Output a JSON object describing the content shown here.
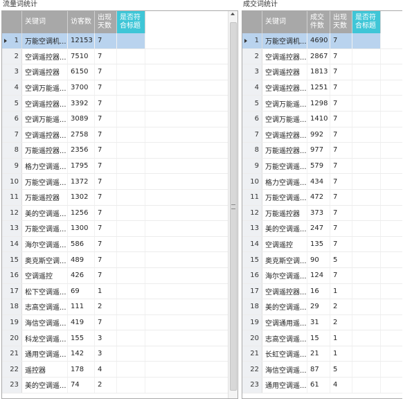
{
  "left_panel": {
    "title": "流量词统计",
    "columns": [
      "",
      "关键词",
      "访客数",
      "出现天数",
      "是否符合标题"
    ],
    "rows": [
      {
        "idx": "1",
        "kw": "万能空调机...",
        "v": "12153",
        "d": "7",
        "t": ""
      },
      {
        "idx": "2",
        "kw": "空调遥控器...",
        "v": "7510",
        "d": "7",
        "t": ""
      },
      {
        "idx": "3",
        "kw": "空调遥控器",
        "v": "6150",
        "d": "7",
        "t": ""
      },
      {
        "idx": "4",
        "kw": "空调万能遥...",
        "v": "3700",
        "d": "7",
        "t": ""
      },
      {
        "idx": "5",
        "kw": "空调遥控器...",
        "v": "3392",
        "d": "7",
        "t": ""
      },
      {
        "idx": "6",
        "kw": "空调万能遥...",
        "v": "3089",
        "d": "7",
        "t": ""
      },
      {
        "idx": "7",
        "kw": "空调遥控器...",
        "v": "2758",
        "d": "7",
        "t": ""
      },
      {
        "idx": "8",
        "kw": "万能遥控器...",
        "v": "2356",
        "d": "7",
        "t": ""
      },
      {
        "idx": "9",
        "kw": "格力空调遥...",
        "v": "1795",
        "d": "7",
        "t": ""
      },
      {
        "idx": "10",
        "kw": "万能空调遥...",
        "v": "1372",
        "d": "7",
        "t": ""
      },
      {
        "idx": "11",
        "kw": "万能遥控器",
        "v": "1302",
        "d": "7",
        "t": ""
      },
      {
        "idx": "12",
        "kw": "美的空调遥...",
        "v": "1256",
        "d": "7",
        "t": ""
      },
      {
        "idx": "13",
        "kw": "万能空调遥...",
        "v": "1300",
        "d": "7",
        "t": ""
      },
      {
        "idx": "14",
        "kw": "海尔空调遥...",
        "v": "586",
        "d": "7",
        "t": ""
      },
      {
        "idx": "15",
        "kw": "奥克斯空调...",
        "v": "489",
        "d": "7",
        "t": ""
      },
      {
        "idx": "16",
        "kw": "空调遥控",
        "v": "426",
        "d": "7",
        "t": ""
      },
      {
        "idx": "17",
        "kw": "松下空调遥...",
        "v": "69",
        "d": "1",
        "t": ""
      },
      {
        "idx": "18",
        "kw": "志高空调遥...",
        "v": "111",
        "d": "2",
        "t": ""
      },
      {
        "idx": "19",
        "kw": "海信空调遥...",
        "v": "419",
        "d": "7",
        "t": ""
      },
      {
        "idx": "20",
        "kw": "科龙空调遥...",
        "v": "155",
        "d": "3",
        "t": ""
      },
      {
        "idx": "21",
        "kw": "通用空调遥...",
        "v": "142",
        "d": "3",
        "t": ""
      },
      {
        "idx": "22",
        "kw": "遥控器",
        "v": "178",
        "d": "4",
        "t": ""
      },
      {
        "idx": "23",
        "kw": "美的空调遥...",
        "v": "74",
        "d": "2",
        "t": ""
      }
    ]
  },
  "right_panel": {
    "title": "成交词统计",
    "columns": [
      "",
      "关键词",
      "成交件数",
      "出现天数",
      "是否符合标题"
    ],
    "rows": [
      {
        "idx": "1",
        "kw": "万能空调机...",
        "v": "4690",
        "d": "7",
        "t": ""
      },
      {
        "idx": "2",
        "kw": "空调遥控器...",
        "v": "2867",
        "d": "7",
        "t": ""
      },
      {
        "idx": "3",
        "kw": "空调遥控器",
        "v": "1813",
        "d": "7",
        "t": ""
      },
      {
        "idx": "4",
        "kw": "空调遥控器...",
        "v": "1251",
        "d": "7",
        "t": ""
      },
      {
        "idx": "5",
        "kw": "空调万能遥...",
        "v": "1298",
        "d": "7",
        "t": ""
      },
      {
        "idx": "6",
        "kw": "空调万能遥...",
        "v": "1410",
        "d": "7",
        "t": ""
      },
      {
        "idx": "7",
        "kw": "空调遥控器...",
        "v": "992",
        "d": "7",
        "t": ""
      },
      {
        "idx": "8",
        "kw": "万能遥控器...",
        "v": "977",
        "d": "7",
        "t": ""
      },
      {
        "idx": "9",
        "kw": "万能空调遥...",
        "v": "579",
        "d": "7",
        "t": ""
      },
      {
        "idx": "10",
        "kw": "格力空调遥...",
        "v": "434",
        "d": "7",
        "t": ""
      },
      {
        "idx": "11",
        "kw": "万能空调遥...",
        "v": "472",
        "d": "7",
        "t": ""
      },
      {
        "idx": "12",
        "kw": "万能遥控器",
        "v": "373",
        "d": "7",
        "t": ""
      },
      {
        "idx": "13",
        "kw": "美的空调遥...",
        "v": "247",
        "d": "7",
        "t": ""
      },
      {
        "idx": "14",
        "kw": "空调遥控",
        "v": "135",
        "d": "7",
        "t": ""
      },
      {
        "idx": "15",
        "kw": "奥克斯空调...",
        "v": "90",
        "d": "5",
        "t": ""
      },
      {
        "idx": "16",
        "kw": "海尔空调遥...",
        "v": "124",
        "d": "7",
        "t": ""
      },
      {
        "idx": "17",
        "kw": "空调遥控器...",
        "v": "16",
        "d": "1",
        "t": ""
      },
      {
        "idx": "18",
        "kw": "美的空调遥...",
        "v": "29",
        "d": "2",
        "t": ""
      },
      {
        "idx": "19",
        "kw": "空调通用遥...",
        "v": "31",
        "d": "2",
        "t": ""
      },
      {
        "idx": "20",
        "kw": "志高空调遥...",
        "v": "15",
        "d": "1",
        "t": ""
      },
      {
        "idx": "21",
        "kw": "长虹空调遥...",
        "v": "21",
        "d": "1",
        "t": ""
      },
      {
        "idx": "22",
        "kw": "海信空调遥...",
        "v": "87",
        "d": "5",
        "t": ""
      },
      {
        "idx": "23",
        "kw": "通用空调遥...",
        "v": "61",
        "d": "4",
        "t": ""
      }
    ]
  },
  "selected_row_index": 0,
  "colors": {
    "header": "#a8a8a8",
    "header_highlight": "#3fc6d7",
    "selection": "#b9d3ee"
  }
}
